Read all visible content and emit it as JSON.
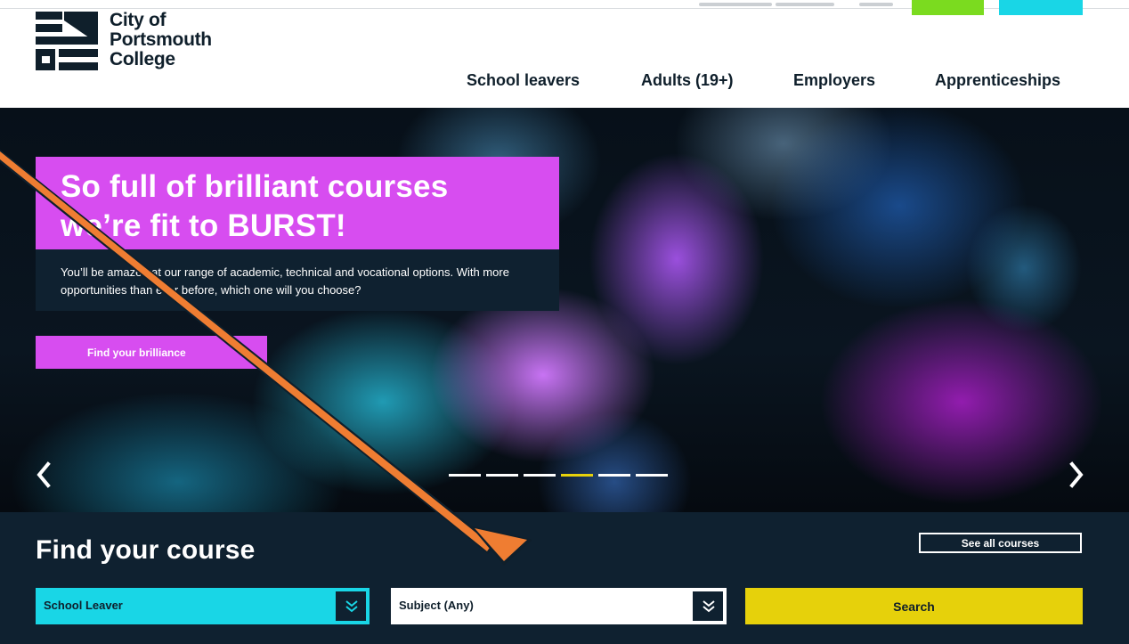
{
  "header": {
    "logo": {
      "lines": [
        "City of",
        "Portsmouth",
        "College"
      ],
      "icon": "college-logo-mark"
    },
    "nav": [
      {
        "label": "School leavers"
      },
      {
        "label": "Adults (19+)"
      },
      {
        "label": "Employers"
      },
      {
        "label": "Apprenticeships"
      }
    ],
    "utility_colors": {
      "apply": "#7bdb1f",
      "secondary": "#19d6e6"
    }
  },
  "hero": {
    "title_lines": [
      "So full of brilliant courses",
      "we’re fit to BURST!"
    ],
    "text": "You’ll be amazed at our range of academic, technical and vocational options. With more opportunities than ever before, which one will you choose?",
    "cta_label": "Find your brilliance",
    "prev_icon": "chevron-left-icon",
    "next_icon": "chevron-right-icon",
    "slides": {
      "count": 6,
      "active_index": 3
    },
    "colors": {
      "title_bg": "#d74df0",
      "text_bg": "#0f2130",
      "active_dot": "#e6d10b"
    }
  },
  "finder": {
    "title": "Find your course",
    "see_all_label": "See all courses",
    "audience_select": {
      "value": "School Leaver",
      "icon": "double-chevron-down-icon"
    },
    "subject_select": {
      "value": "Subject (Any)",
      "icon": "double-chevron-down-icon"
    },
    "search_label": "Search",
    "colors": {
      "background": "#0f2130",
      "audience_bg": "#19d6e6",
      "search_bg": "#e6d10b"
    }
  },
  "annotation": {
    "icon": "arrow-annotation",
    "color": "#ef7d32"
  }
}
